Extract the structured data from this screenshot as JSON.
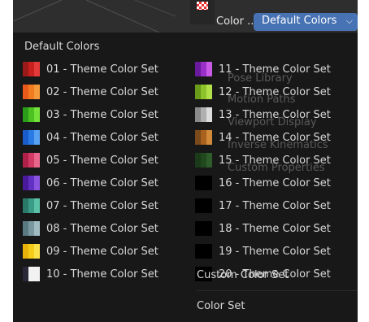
{
  "header": {
    "label": "Color ...",
    "selected": "Default Colors"
  },
  "background_items": [
    "Pose Library",
    "Motion Paths",
    "Viewport Display",
    "Inverse Kinematics",
    "Custom Properties"
  ],
  "menu": {
    "default_label": "Default Colors",
    "custom_label": "Custom Color Set",
    "footer_label": "Color Set",
    "left": [
      {
        "label": "01 - Theme Color Set",
        "colors": [
          "#9c1a1a",
          "#c92020",
          "#e53a3a"
        ]
      },
      {
        "label": "02 - Theme Color Set",
        "colors": [
          "#e85a1a",
          "#f27a20",
          "#f59a3a"
        ]
      },
      {
        "label": "03 - Theme Color Set",
        "colors": [
          "#2a9c1a",
          "#4cc222",
          "#74e23a"
        ]
      },
      {
        "label": "04 - Theme Color Set",
        "colors": [
          "#1a5ccc",
          "#2a7ae6",
          "#58a0f2"
        ]
      },
      {
        "label": "05 - Theme Color Set",
        "colors": [
          "#b0214a",
          "#d23a64",
          "#e6668c"
        ]
      },
      {
        "label": "06 - Theme Color Set",
        "colors": [
          "#4a1a9c",
          "#6230c2",
          "#8a54e0"
        ]
      },
      {
        "label": "07 - Theme Color Set",
        "colors": [
          "#2a7a6a",
          "#3a9c86",
          "#5ac0a6"
        ]
      },
      {
        "label": "08 - Theme Color Set",
        "colors": [
          "#5a7a82",
          "#7a98a0",
          "#a0bcc2"
        ]
      },
      {
        "label": "09 - Theme Color Set",
        "colors": [
          "#e8b20a",
          "#f5cc1a",
          "#fce24a"
        ]
      },
      {
        "label": "10 - Theme Color Set",
        "colors": [
          "#282838",
          "#f2f2f2",
          "#f2f2f2"
        ]
      }
    ],
    "right": [
      {
        "label": "11 - Theme Color Set",
        "colors": [
          "#6a1a9c",
          "#9a30c8",
          "#c85ae6"
        ]
      },
      {
        "label": "12 - Theme Color Set",
        "colors": [
          "#6a9c1a",
          "#8cc22a",
          "#b2e04a"
        ]
      },
      {
        "label": "13 - Theme Color Set",
        "colors": [
          "#8a8a8a",
          "#b0b0b0",
          "#dcdcdc"
        ]
      },
      {
        "label": "14 - Theme Color Set",
        "colors": [
          "#7a4a1a",
          "#a8621e",
          "#d08a3a"
        ]
      },
      {
        "label": "15 - Theme Color Set",
        "colors": [
          "#1a3a1a",
          "#204a1e",
          "#2e5c2a"
        ]
      },
      {
        "label": "16 - Theme Color Set",
        "colors": [
          "#000000",
          "#000000",
          "#000000"
        ]
      },
      {
        "label": "17 - Theme Color Set",
        "colors": [
          "#000000",
          "#000000",
          "#000000"
        ]
      },
      {
        "label": "18 - Theme Color Set",
        "colors": [
          "#000000",
          "#000000",
          "#000000"
        ]
      },
      {
        "label": "19 - Theme Color Set",
        "colors": [
          "#000000",
          "#000000",
          "#000000"
        ]
      },
      {
        "label": "20 - Theme Color Set",
        "colors": [
          "#000000",
          "#000000",
          "#000000"
        ]
      }
    ]
  }
}
